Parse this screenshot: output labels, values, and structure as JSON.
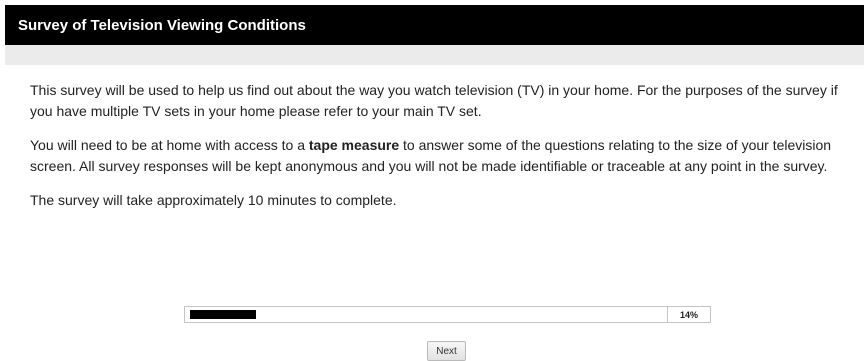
{
  "header": {
    "title": "Survey of Television Viewing Conditions"
  },
  "body": {
    "paragraph1": "This survey will be used to help us find out about the way you watch television (TV) in your home. For the purposes of the survey if you have multiple TV sets in your home please refer to your main TV set.",
    "paragraph2_before": "You will need to be at home with access to a ",
    "paragraph2_bold": "tape measure",
    "paragraph2_after": " to answer some of the questions relating to the size of your television screen. All survey responses will be kept anonymous and you will not be made identifiable or traceable at any point in the survey.",
    "paragraph3": "The survey will take approximately 10 minutes to complete."
  },
  "progress": {
    "value": 0.14,
    "label": "14%"
  },
  "footer": {
    "next_label": "Next"
  },
  "colors": {
    "header_bg": "#000000",
    "header_text": "#ffffff",
    "band": "#ebebeb",
    "progress_fill": "#000000"
  }
}
